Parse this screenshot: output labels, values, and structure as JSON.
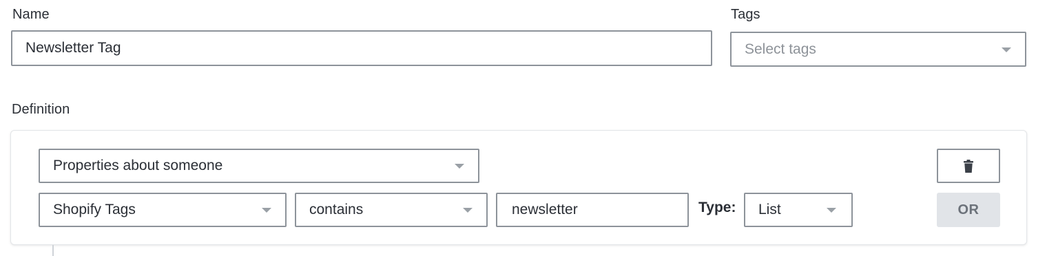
{
  "name_section": {
    "label": "Name",
    "value": "Newsletter Tag"
  },
  "tags_section": {
    "label": "Tags",
    "placeholder": "Select tags"
  },
  "definition": {
    "label": "Definition",
    "condition_type": "Properties about someone",
    "property": "Shopify Tags",
    "operator": "contains",
    "value": "newsletter",
    "type_label": "Type:",
    "type_value": "List",
    "or_label": "OR",
    "delete_icon": "trash-icon"
  }
}
